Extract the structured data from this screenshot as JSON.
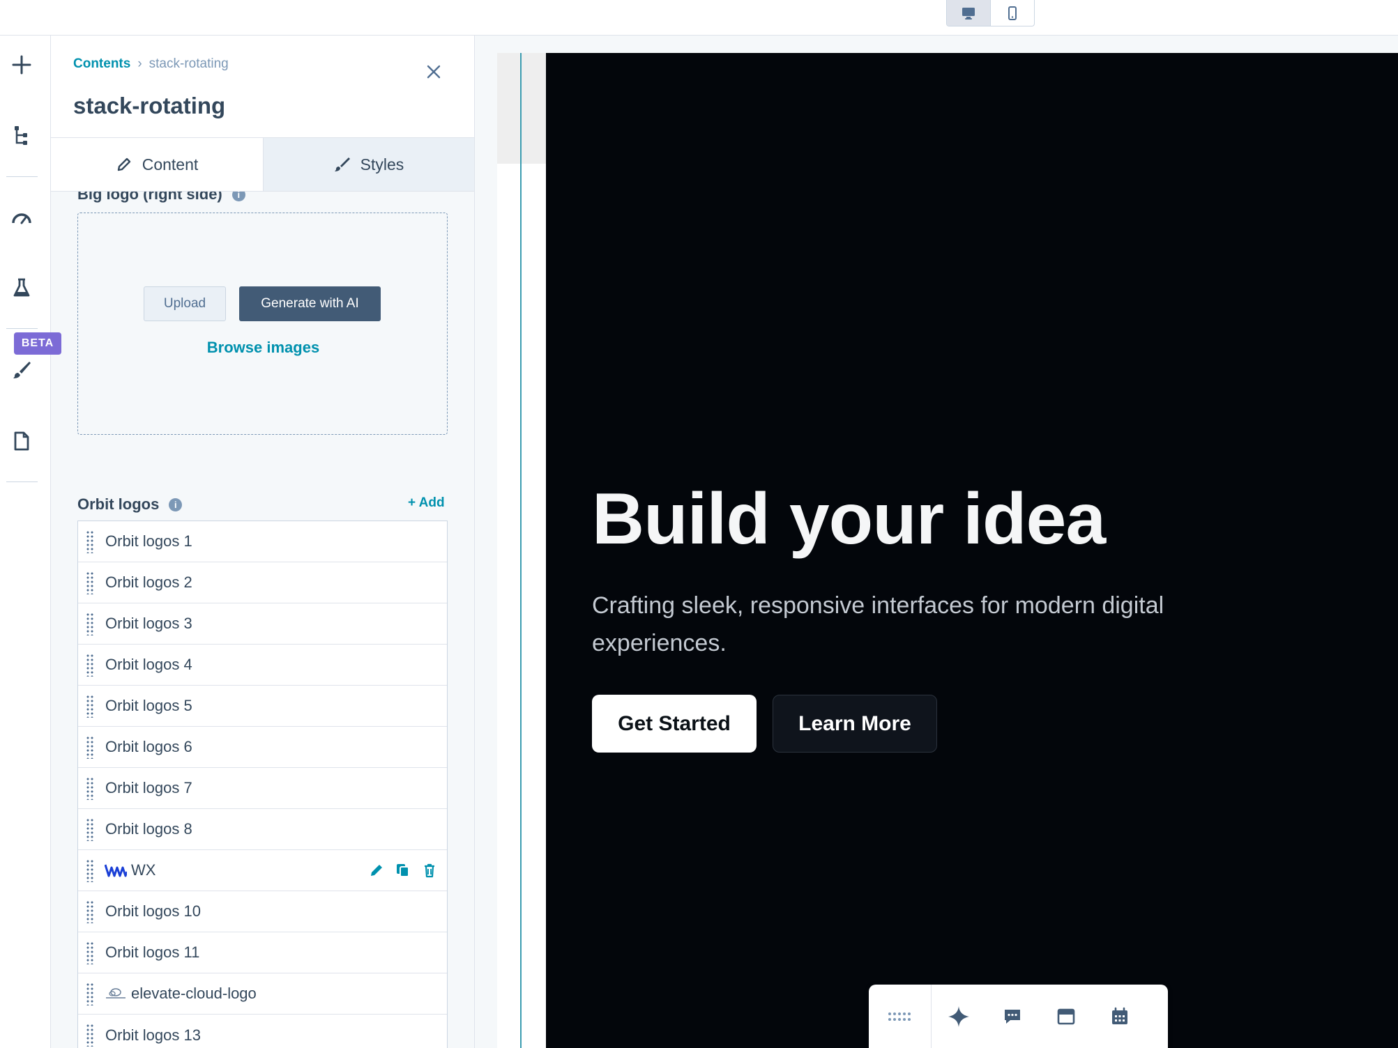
{
  "device_toggle": {
    "desktop_icon": "desktop-icon",
    "mobile_icon": "mobile-icon"
  },
  "rail": {
    "items": [
      {
        "icon": "plus-icon"
      },
      {
        "icon": "tree-structure-icon"
      },
      {
        "icon": "speedometer-icon"
      },
      {
        "icon": "flask-icon"
      },
      {
        "icon": "brush-icon",
        "badge": "BETA"
      },
      {
        "icon": "page-icon"
      }
    ]
  },
  "panel": {
    "breadcrumb": {
      "root": "Contents",
      "separator": "›",
      "current": "stack-rotating"
    },
    "title": "stack-rotating",
    "tabs": [
      {
        "label": "Content",
        "icon": "pencil-icon",
        "active": true
      },
      {
        "label": "Styles",
        "icon": "brush-icon",
        "active": false
      }
    ],
    "big_logo": {
      "label": "Big logo (right side)",
      "upload_label": "Upload",
      "generate_label": "Generate with AI",
      "browse_label": "Browse images"
    },
    "orbit_logos": {
      "label": "Orbit logos",
      "add_label": "+ Add",
      "items": [
        {
          "label": "Orbit logos 1"
        },
        {
          "label": "Orbit logos 2"
        },
        {
          "label": "Orbit logos 3"
        },
        {
          "label": "Orbit logos 4"
        },
        {
          "label": "Orbit logos 5"
        },
        {
          "label": "Orbit logos 6"
        },
        {
          "label": "Orbit logos 7"
        },
        {
          "label": "Orbit logos 8"
        },
        {
          "label": "WX",
          "thumb": "wx-logo",
          "hovered": true
        },
        {
          "label": "Orbit logos 10"
        },
        {
          "label": "Orbit logos 11"
        },
        {
          "label": "elevate-cloud-logo",
          "thumb": "elevate-cloud-logo"
        },
        {
          "label": "Orbit logos 13"
        }
      ]
    }
  },
  "preview": {
    "title": "Build your idea",
    "subtitle": "Crafting sleek, responsive interfaces for modern digital experiences.",
    "primary_cta": "Get Started",
    "secondary_cta": "Learn More"
  },
  "floating_toolbar": {
    "items": [
      "grip-icon",
      "sparkle-icon",
      "chat-icon",
      "browser-window-icon",
      "calendar-icon"
    ]
  },
  "colors": {
    "accent": "#0091ae",
    "dark_button": "#425b76",
    "beta": "#7c6bd6",
    "hero_bg": "#03060b"
  }
}
